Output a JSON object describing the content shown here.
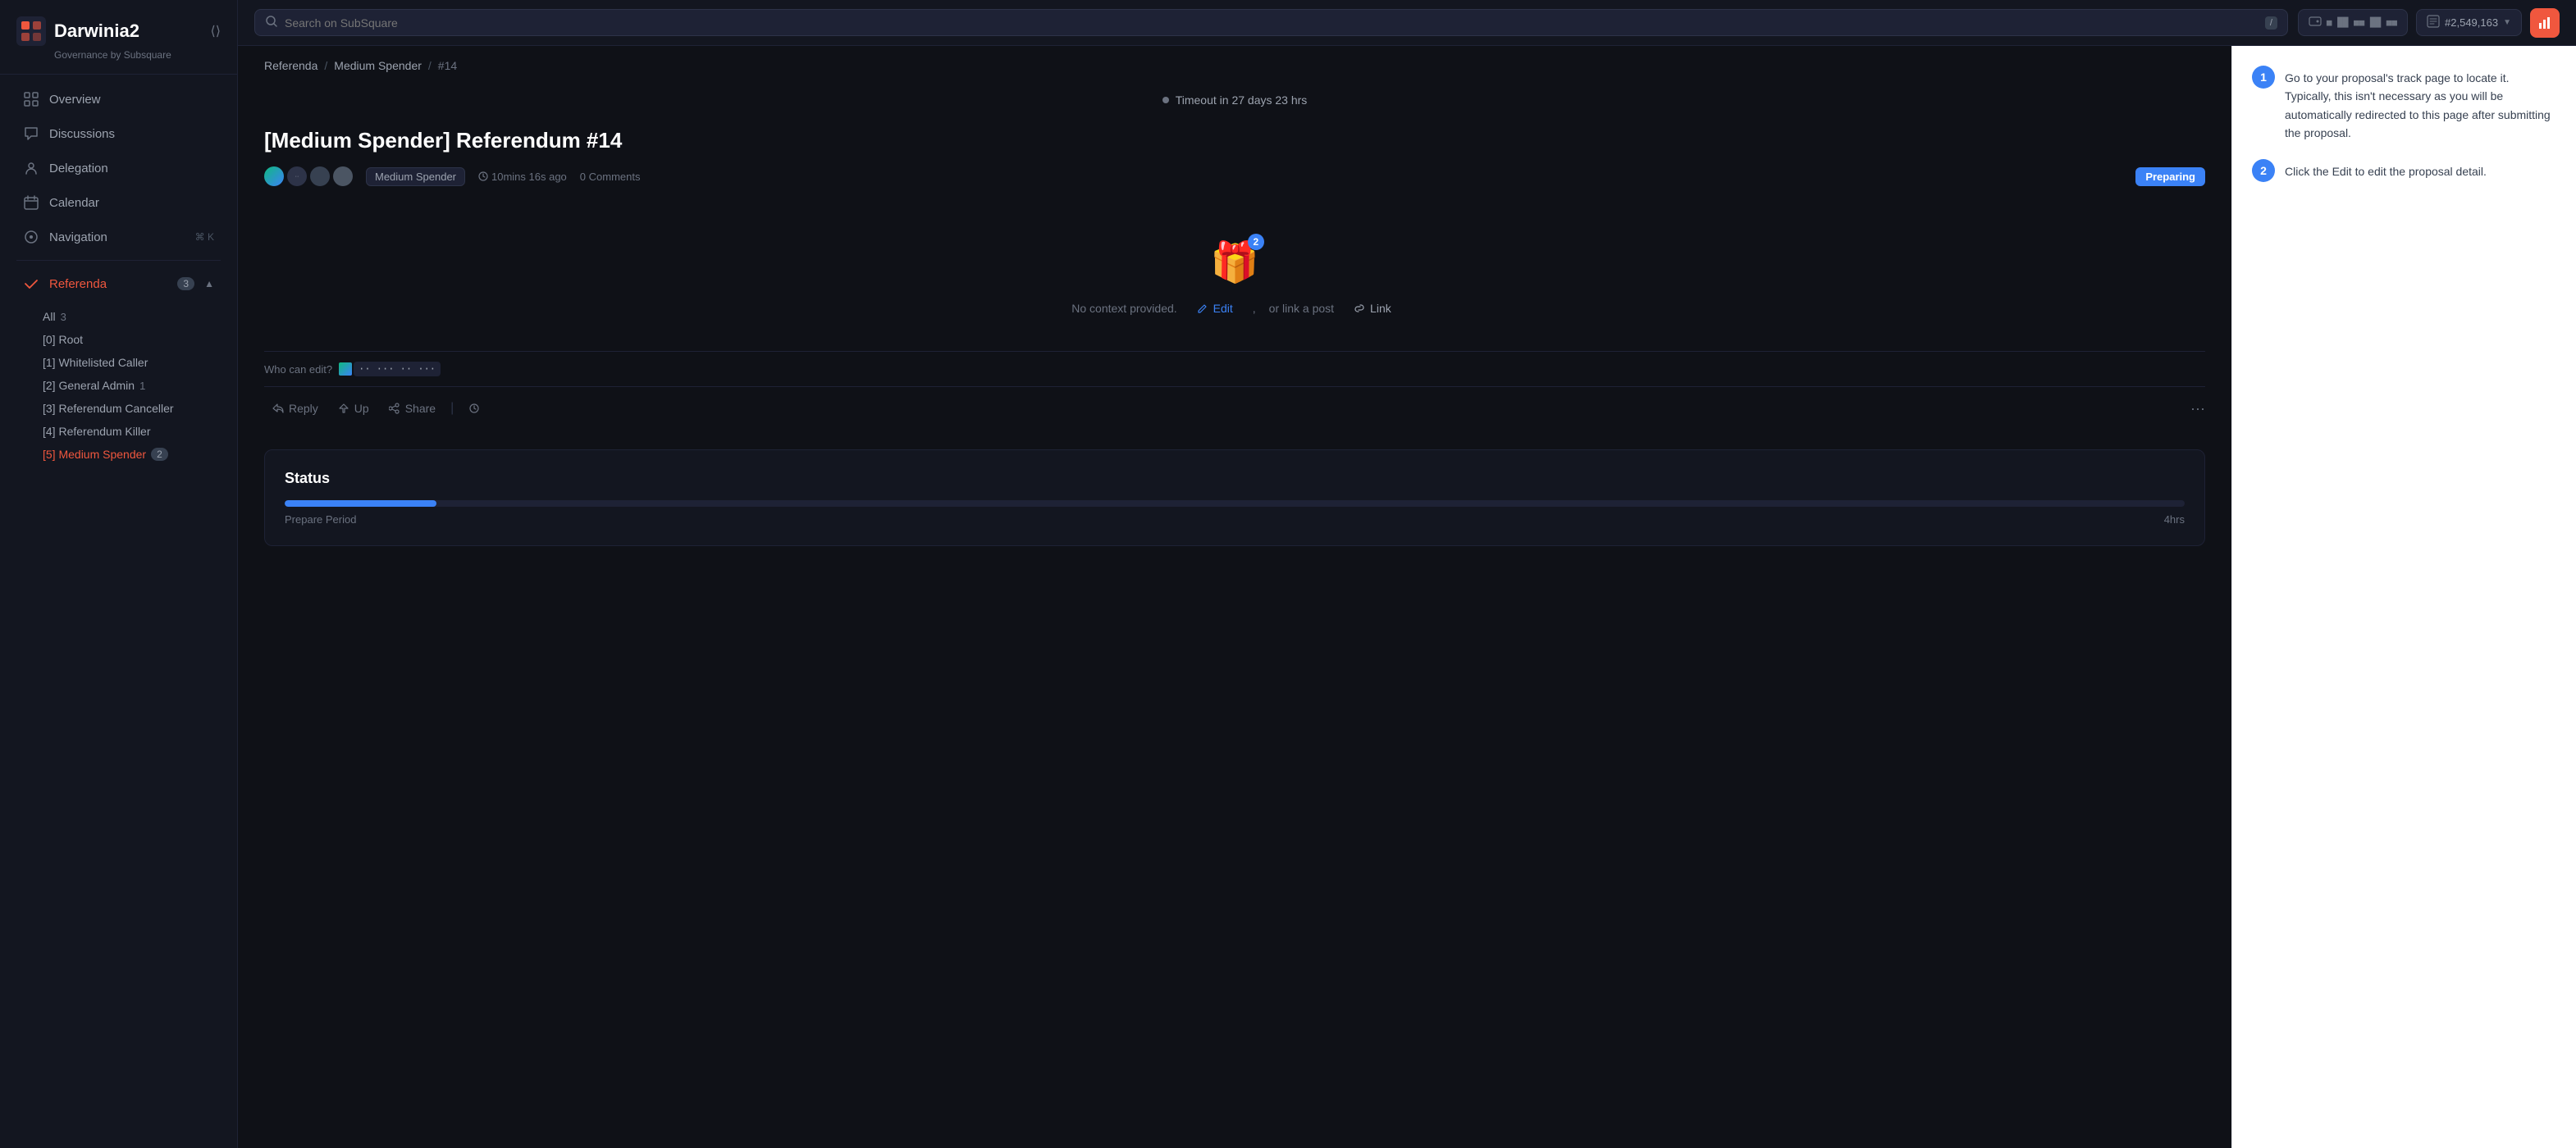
{
  "brand": {
    "name": "Darwinia2",
    "subtitle": "Governance by Subsquare",
    "logo_symbol": "⊞"
  },
  "topbar": {
    "search_placeholder": "Search on SubSquare",
    "kbd_shortcut": "/",
    "block_number": "#2,549,163",
    "wallet_display": "wallet"
  },
  "sidebar": {
    "items": [
      {
        "id": "overview",
        "label": "Overview",
        "icon": "⊞"
      },
      {
        "id": "discussions",
        "label": "Discussions",
        "icon": "💬"
      },
      {
        "id": "delegation",
        "label": "Delegation",
        "icon": "👤"
      },
      {
        "id": "calendar",
        "label": "Calendar",
        "icon": "📅"
      },
      {
        "id": "navigation",
        "label": "Navigation",
        "icon": "⊕",
        "shortcut": "⌘ K"
      }
    ],
    "referenda": {
      "label": "Referenda",
      "count": 3,
      "sub_items": [
        {
          "id": "all",
          "label": "All",
          "count": "3"
        },
        {
          "id": "root",
          "label": "[0] Root",
          "count": ""
        },
        {
          "id": "whitelisted",
          "label": "[1] Whitelisted Caller",
          "count": ""
        },
        {
          "id": "general-admin",
          "label": "[2] General Admin",
          "count": "1"
        },
        {
          "id": "referendum-canceller",
          "label": "[3] Referendum Canceller",
          "count": ""
        },
        {
          "id": "referendum-killer",
          "label": "[4] Referendum Killer",
          "count": ""
        },
        {
          "id": "medium-spender",
          "label": "[5] Medium Spender",
          "count": "2",
          "active": true
        }
      ]
    }
  },
  "breadcrumb": {
    "items": [
      "Referenda",
      "Medium Spender",
      "#14"
    ]
  },
  "proposal": {
    "timeout": "Timeout in 27 days 23 hrs",
    "title": "[Medium Spender] Referendum #14",
    "track": "Medium Spender",
    "time_ago": "10mins 16s ago",
    "comments": "0 Comments",
    "status": "Preparing",
    "no_context_text": "No context provided.",
    "edit_label": "Edit",
    "link_label": "Link",
    "or_label": "or link a post",
    "who_can_edit_label": "Who can edit?",
    "tooltip_badge": "2",
    "actions": {
      "reply": "Reply",
      "up": "Up",
      "share": "Share"
    }
  },
  "status_section": {
    "title": "Status",
    "prepare_period": "Prepare Period",
    "duration": "4hrs",
    "progress_percent": 8
  },
  "right_panel": {
    "steps": [
      {
        "number": "1",
        "text": "Go to your proposal's track page to locate it. Typically, this isn't necessary as you will be automatically redirected to this page after submitting the proposal."
      },
      {
        "number": "2",
        "text": "Click the Edit to edit the proposal detail."
      }
    ]
  }
}
